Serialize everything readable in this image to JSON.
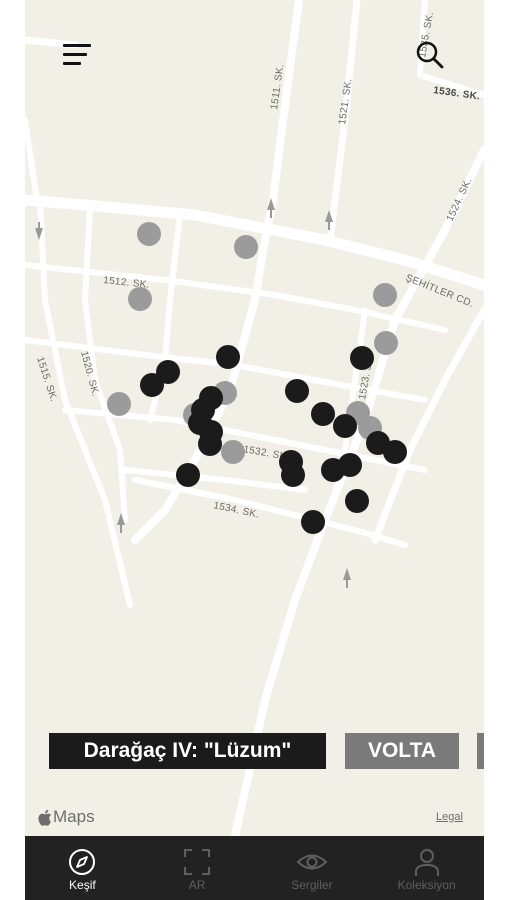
{
  "map": {
    "streets": [
      "1511. SK.",
      "1521. SK.",
      "1535. SK.",
      "1536. SK.",
      "1524. SK.",
      "1512. SK.",
      "ŞEHİTLER CD.",
      "1515. SK.",
      "1520. SK.",
      "1523. SK.",
      "1532. SK.",
      "1534. SK."
    ],
    "markers": {
      "active_color": "#1b1b1b",
      "inactive_color": "#9b9b9b",
      "active_count": 27,
      "inactive_count": 11
    }
  },
  "header": {
    "menu_icon": "hamburger-menu-icon",
    "search_icon": "search-icon"
  },
  "exhibitions": [
    {
      "label": "Darağaç IV: \"Lüzum\"",
      "color": "#1b1b1b"
    },
    {
      "label": "VOLTA",
      "color": "#7a7a7a"
    },
    {
      "label": "",
      "color": "#7a7a7a"
    }
  ],
  "attribution": {
    "maps_text": "Maps",
    "apple_icon": "apple-logo-icon",
    "legal": "Legal"
  },
  "tabs": [
    {
      "label": "Keşif",
      "icon": "compass-icon",
      "active": true
    },
    {
      "label": "AR",
      "icon": "ar-frame-icon",
      "active": false
    },
    {
      "label": "Sergiler",
      "icon": "eye-icon",
      "active": false
    },
    {
      "label": "Koleksiyon",
      "icon": "person-icon",
      "active": false
    }
  ]
}
